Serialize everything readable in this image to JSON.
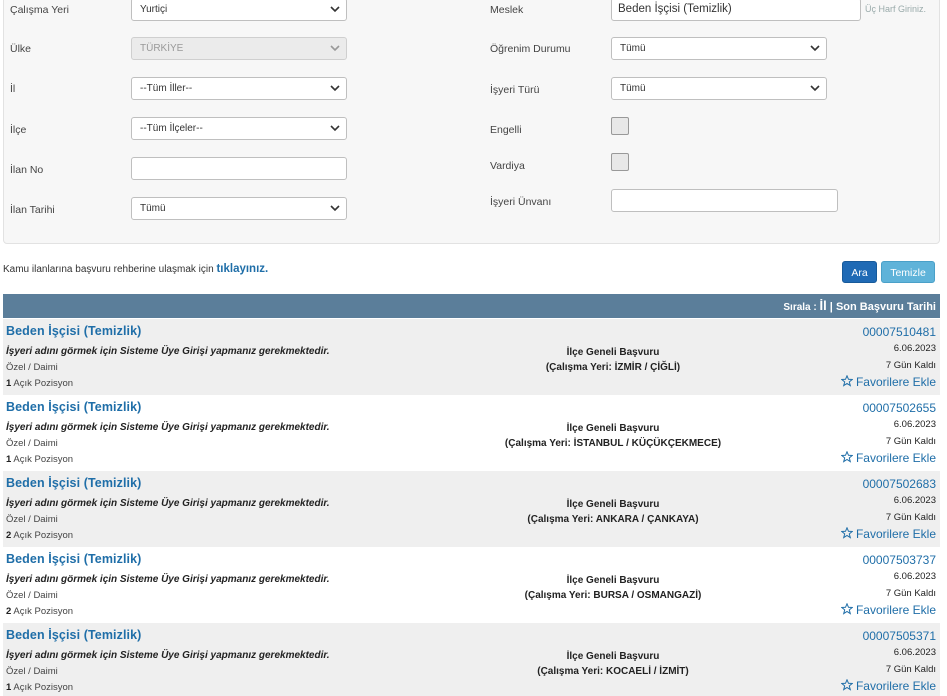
{
  "form": {
    "calisma_yeri": {
      "label": "Çalışma Yeri",
      "value": "Yurtiçi"
    },
    "ulke": {
      "label": "Ülke",
      "value": "TÜRKİYE"
    },
    "il": {
      "label": "İl",
      "value": "--Tüm İller--"
    },
    "ilce": {
      "label": "İlçe",
      "value": "--Tüm İlçeler--"
    },
    "ilan_no": {
      "label": "İlan No",
      "value": ""
    },
    "ilan_tarihi": {
      "label": "İlan Tarihi",
      "value": "Tümü"
    },
    "meslek": {
      "label": "Meslek",
      "value": "Beden İşçisi (Temizlik)",
      "hint": "Üç Harf Giriniz."
    },
    "ogrenim_durumu": {
      "label": "Öğrenim Durumu",
      "value": "Tümü"
    },
    "isyeri_turu": {
      "label": "İşyeri Türü",
      "value": "Tümü"
    },
    "engelli": {
      "label": "Engelli"
    },
    "vardiya": {
      "label": "Vardiya"
    },
    "isyeri_unvani": {
      "label": "İşyeri Ünvanı",
      "value": ""
    }
  },
  "guide": {
    "text": "Kamu ilanlarına başvuru rehberine ulaşmak için ",
    "link": "tıklayınız."
  },
  "buttons": {
    "ara": "Ara",
    "temizle": "Temizle"
  },
  "sortbar": {
    "prefix": "Sırala : ",
    "il": "İl",
    "sep": " | ",
    "son": "Son Başvuru Tarihi"
  },
  "listings": [
    {
      "title": "Beden İşçisi (Temizlik)",
      "notice": "İşyeri adını görmek için Sisteme Üye Girişi yapmanız gerekmektedir.",
      "type": "Özel / Daimi",
      "positions": "1",
      "positions_label": " Açık Pozisyon",
      "apply": "İlçe Geneli Başvuru",
      "location": "(Çalışma Yeri: İZMİR / ÇİĞLİ)",
      "no": "00007510481",
      "date": "6.06.2023",
      "days": "7 Gün Kaldı",
      "fav": "Favorilere Ekle"
    },
    {
      "title": "Beden İşçisi (Temizlik)",
      "notice": "İşyeri adını görmek için Sisteme Üye Girişi yapmanız gerekmektedir.",
      "type": "Özel / Daimi",
      "positions": "1",
      "positions_label": " Açık Pozisyon",
      "apply": "İlçe Geneli Başvuru",
      "location": "(Çalışma Yeri: İSTANBUL / KÜÇÜKÇEKMECE)",
      "no": "00007502655",
      "date": "6.06.2023",
      "days": "7 Gün Kaldı",
      "fav": "Favorilere Ekle"
    },
    {
      "title": "Beden İşçisi (Temizlik)",
      "notice": "İşyeri adını görmek için Sisteme Üye Girişi yapmanız gerekmektedir.",
      "type": "Özel / Daimi",
      "positions": "2",
      "positions_label": " Açık Pozisyon",
      "apply": "İlçe Geneli Başvuru",
      "location": "(Çalışma Yeri: ANKARA / ÇANKAYA)",
      "no": "00007502683",
      "date": "6.06.2023",
      "days": "7 Gün Kaldı",
      "fav": "Favorilere Ekle"
    },
    {
      "title": "Beden İşçisi (Temizlik)",
      "notice": "İşyeri adını görmek için Sisteme Üye Girişi yapmanız gerekmektedir.",
      "type": "Özel / Daimi",
      "positions": "2",
      "positions_label": " Açık Pozisyon",
      "apply": "İlçe Geneli Başvuru",
      "location": "(Çalışma Yeri: BURSA / OSMANGAZİ)",
      "no": "00007503737",
      "date": "6.06.2023",
      "days": "7 Gün Kaldı",
      "fav": "Favorilere Ekle"
    },
    {
      "title": "Beden İşçisi (Temizlik)",
      "notice": "İşyeri adını görmek için Sisteme Üye Girişi yapmanız gerekmektedir.",
      "type": "Özel / Daimi",
      "positions": "1",
      "positions_label": " Açık Pozisyon",
      "apply": "İlçe Geneli Başvuru",
      "location": "(Çalışma Yeri: KOCAELİ / İZMİT)",
      "no": "00007505371",
      "date": "6.06.2023",
      "days": "7 Gün Kaldı",
      "fav": "Favorilere Ekle"
    }
  ]
}
